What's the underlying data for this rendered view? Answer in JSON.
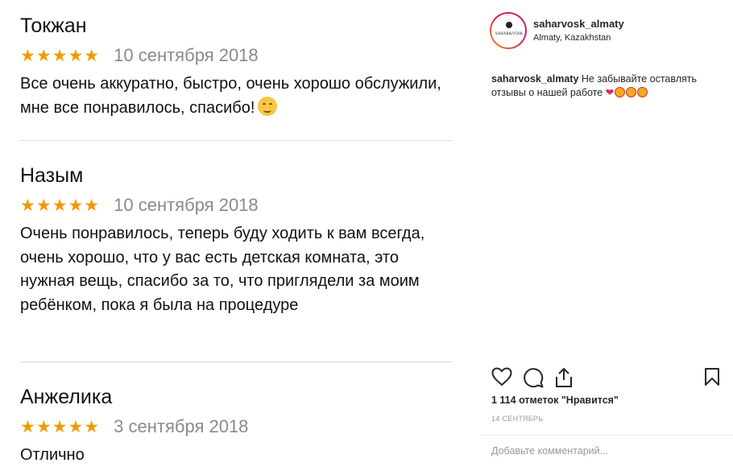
{
  "reviews": [
    {
      "name": "Токжан",
      "stars": "★★★★★",
      "date": "10 сентября 2018",
      "text": "Все очень аккуратно, быстро, очень хорошо обслужили, мне все понравилось, спасибо!"
    },
    {
      "name": "Назым",
      "stars": "★★★★★",
      "date": "10 сентября 2018",
      "text": "Очень понравилось, теперь буду ходить к вам всегда, очень хорошо, что у вас есть детская комната, это нужная вещь, спасибо за то, что приглядели за моим ребёнком, пока я была на процедуре"
    },
    {
      "name": "Анжелика",
      "stars": "★★★★★",
      "date": "3 сентября 2018",
      "text": "Отлично"
    }
  ],
  "post": {
    "username": "saharvosk_almaty",
    "location": "Almaty, Kazakhstan",
    "avatar_logo": "SAHAR&VOSK",
    "caption_user": "saharvosk_almaty",
    "caption_text": "Не забывайте оставлять отзывы о нашей работе",
    "likes": "1 114 отметок \"Нравится\"",
    "date": "14 СЕНТЯБРЬ",
    "comment_placeholder": "Добавьте комментарий..."
  },
  "colors": {
    "stars": "#f29900",
    "heart": "#e0245e"
  }
}
